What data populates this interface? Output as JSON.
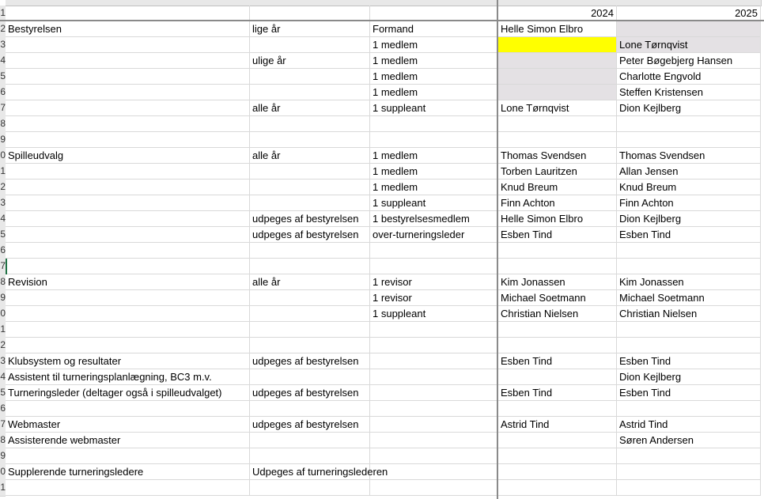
{
  "years": [
    "2024",
    "2025"
  ],
  "row_numbers": [
    "1",
    "2",
    "3",
    "4",
    "5",
    "6",
    "7",
    "8",
    "9",
    "0",
    "1",
    "2",
    "3",
    "4",
    "5",
    "6",
    "7",
    "8",
    "9",
    "0",
    "1",
    "2",
    "3",
    "4",
    "5",
    "6",
    "7",
    "8",
    "9",
    "0",
    "1"
  ],
  "rows": [
    {
      "a": "",
      "b": "",
      "c": "",
      "d": "",
      "e": ""
    },
    {
      "a": "Bestyrelsen",
      "b": "lige år",
      "c": "Formand",
      "d": "Helle Simon Elbro",
      "e": ""
    },
    {
      "a": "",
      "b": "",
      "c": "1 medlem",
      "d": "",
      "e": "Lone Tørnqvist"
    },
    {
      "a": "",
      "b": "ulige år",
      "c": "1 medlem",
      "d": "",
      "e": "Peter Bøgebjerg Hansen"
    },
    {
      "a": "",
      "b": "",
      "c": "1 medlem",
      "d": "",
      "e": "Charlotte Engvold"
    },
    {
      "a": "",
      "b": "",
      "c": "1 medlem",
      "d": "",
      "e": "Steffen Kristensen"
    },
    {
      "a": "",
      "b": "alle år",
      "c": "1 suppleant",
      "d": "Lone Tørnqvist",
      "e": "Dion Kejlberg"
    },
    {
      "a": "",
      "b": "",
      "c": "",
      "d": "",
      "e": ""
    },
    {
      "a": "",
      "b": "",
      "c": "",
      "d": "",
      "e": ""
    },
    {
      "a": "Spilleudvalg",
      "b": "alle år",
      "c": "1 medlem",
      "d": "Thomas Svendsen",
      "e": "Thomas Svendsen"
    },
    {
      "a": "",
      "b": "",
      "c": "1 medlem",
      "d": "Torben Lauritzen",
      "e": "Allan Jensen"
    },
    {
      "a": "",
      "b": "",
      "c": "1 medlem",
      "d": "Knud Breum",
      "e": "Knud Breum"
    },
    {
      "a": "",
      "b": "",
      "c": "1 suppleant",
      "d": "Finn Achton",
      "e": "Finn Achton"
    },
    {
      "a": "",
      "b": "udpeges af bestyrelsen",
      "c": "1 bestyrelsesmedlem",
      "d": "Helle Simon Elbro",
      "e": "Dion Kejlberg"
    },
    {
      "a": "",
      "b": "udpeges af bestyrelsen",
      "c": "over-turneringsleder",
      "d": "Esben Tind",
      "e": "Esben Tind"
    },
    {
      "a": "",
      "b": "",
      "c": "",
      "d": "",
      "e": ""
    },
    {
      "a": "",
      "b": "",
      "c": "",
      "d": "",
      "e": ""
    },
    {
      "a": "Revision",
      "b": "alle år",
      "c": "1 revisor",
      "d": "Kim Jonassen",
      "e": "Kim Jonassen"
    },
    {
      "a": "",
      "b": "",
      "c": "1 revisor",
      "d": "Michael Soetmann",
      "e": "Michael Soetmann"
    },
    {
      "a": "",
      "b": "",
      "c": "1 suppleant",
      "d": "Christian Nielsen",
      "e": "Christian Nielsen"
    },
    {
      "a": "",
      "b": "",
      "c": "",
      "d": "",
      "e": ""
    },
    {
      "a": "",
      "b": "",
      "c": "",
      "d": "",
      "e": ""
    },
    {
      "a": "Klubsystem og resultater",
      "b": "udpeges af bestyrelsen",
      "c": "",
      "d": "Esben Tind",
      "e": "Esben Tind"
    },
    {
      "a": "Assistent til turneringsplanlægning, BC3 m.v.",
      "b": "",
      "c": "",
      "d": "",
      "e": "Dion Kejlberg"
    },
    {
      "a": "Turneringsleder (deltager også i spilleudvalget)",
      "b": "udpeges af bestyrelsen",
      "c": "",
      "d": "Esben Tind",
      "e": "Esben Tind"
    },
    {
      "a": "",
      "b": "",
      "c": "",
      "d": "",
      "e": ""
    },
    {
      "a": "Webmaster",
      "b": "udpeges af bestyrelsen",
      "c": "",
      "d": "Astrid Tind",
      "e": "Astrid Tind"
    },
    {
      "a": "Assisterende webmaster",
      "b": "",
      "c": "",
      "d": "",
      "e": "Søren Andersen"
    },
    {
      "a": "",
      "b": "",
      "c": "",
      "d": "",
      "e": ""
    },
    {
      "a": "Supplerende turneringsledere",
      "b": "Udpeges af turneringslederen",
      "c": "",
      "d": "",
      "e": ""
    },
    {
      "a": "",
      "b": "",
      "c": "",
      "d": "",
      "e": ""
    }
  ],
  "colors": {
    "highlight_yellow": "#ffff00",
    "highlight_gray": "#e4e1e4",
    "selection_green": "#217346"
  }
}
